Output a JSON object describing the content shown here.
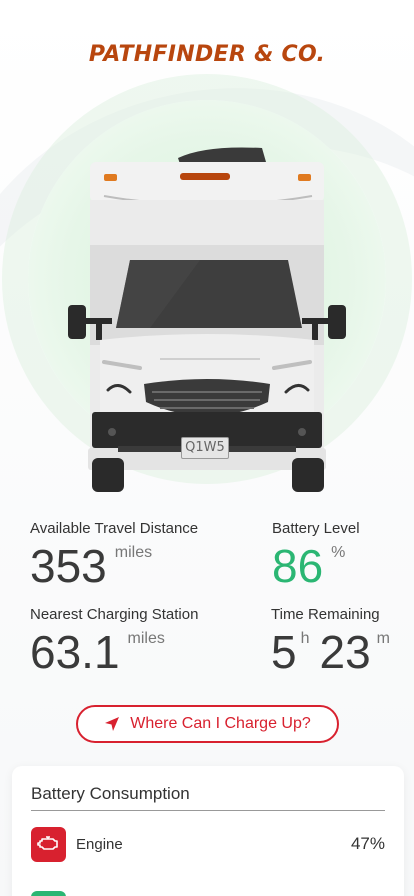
{
  "brand": {
    "name": "PATHFINDER & CO."
  },
  "vehicle": {
    "plate": "Q1W5",
    "accent_color": "#b8460e",
    "glow_color": "#d9f2dc"
  },
  "stats": {
    "travel_distance": {
      "label": "Available Travel Distance",
      "value": "353",
      "unit": "miles"
    },
    "battery_level": {
      "label": "Battery Level",
      "value": "86",
      "unit": "%",
      "color": "#2bb673"
    },
    "nearest_station": {
      "label": "Nearest Charging Station",
      "value": "63.1",
      "unit": "miles"
    },
    "time_remaining": {
      "label": "Time Remaining",
      "hours": "5",
      "hours_unit": "h",
      "minutes": "23",
      "minutes_unit": "m"
    }
  },
  "charge_button": {
    "label": "Where Can I Charge Up?",
    "icon": "navigation-arrow-icon",
    "color": "#d8212f"
  },
  "consumption": {
    "title": "Battery Consumption",
    "items": [
      {
        "label": "Engine",
        "value": "47%",
        "icon": "engine-icon",
        "color": "#d8212f"
      },
      {
        "label": "",
        "value": "",
        "icon": "green-icon",
        "color": "#2bb673"
      }
    ]
  }
}
